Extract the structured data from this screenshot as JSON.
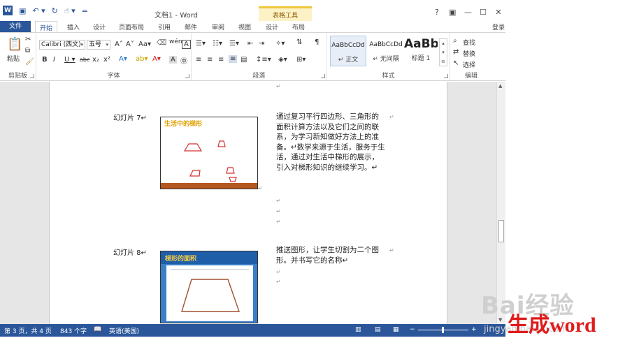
{
  "app": {
    "title": "文档1 - Word",
    "context_tab": "表格工具",
    "login": "登录",
    "qat_icons": [
      "word-logo-icon",
      "save-icon",
      "undo-icon",
      "redo-icon",
      "touch-mode-icon",
      "customize-icon"
    ],
    "word_logo": "W",
    "win_ctrls": [
      "?",
      "▣",
      "—",
      "☐",
      "✕"
    ]
  },
  "tabs": {
    "file": "文件",
    "items": [
      "开始",
      "插入",
      "设计",
      "页面布局",
      "引用",
      "邮件",
      "审阅",
      "视图",
      "设计",
      "布局"
    ],
    "active": "开始"
  },
  "ribbon": {
    "clipboard": {
      "label": "剪贴板",
      "paste": "粘贴"
    },
    "font": {
      "label": "字体",
      "name": "Calibri (西文)",
      "size": "五号"
    },
    "paragraph": {
      "label": "段落"
    },
    "styles": {
      "label": "样式",
      "items": [
        {
          "sample": "AaBbCcDd",
          "name": "↵ 正文"
        },
        {
          "sample": "AaBbCcDd",
          "name": "↵ 无间隔"
        },
        {
          "sample": "AaBb",
          "name": "标题 1"
        }
      ]
    },
    "editing": {
      "label": "编辑",
      "find": "查找",
      "replace": "替换",
      "select": "选择"
    }
  },
  "document": {
    "para_mark": "↵",
    "slides": [
      {
        "label": "幻灯片 7↵",
        "thumb_title": "生活中的梯形",
        "text": "通过复习平行四边形、三角形的面积计算方法以及它们之间的联系，为学习新知做好方法上的准备。↵数学来源于生活，服务于生活，通过对生活中梯形的展示，引入对梯形知识的继续学习。↵"
      },
      {
        "label": "幻灯片 8↵",
        "thumb_title": "梯形的面积",
        "text": "推送图形，让学生切割为二个图形。并书写它的名称↵"
      }
    ]
  },
  "status": {
    "page": "第 3 页，共 4 页",
    "words": "843 个字",
    "lang": "英语(美国)",
    "zoom_minus": "−",
    "zoom_plus": "+"
  },
  "overlay": {
    "watermark": "Bai经验",
    "watermark_sub": "jingyan.baidu.com",
    "caption": "生成word"
  },
  "colors": {
    "word_blue": "#2b579a",
    "context_yellow": "#fdf2c6",
    "caption_red": "#e01b1b"
  }
}
